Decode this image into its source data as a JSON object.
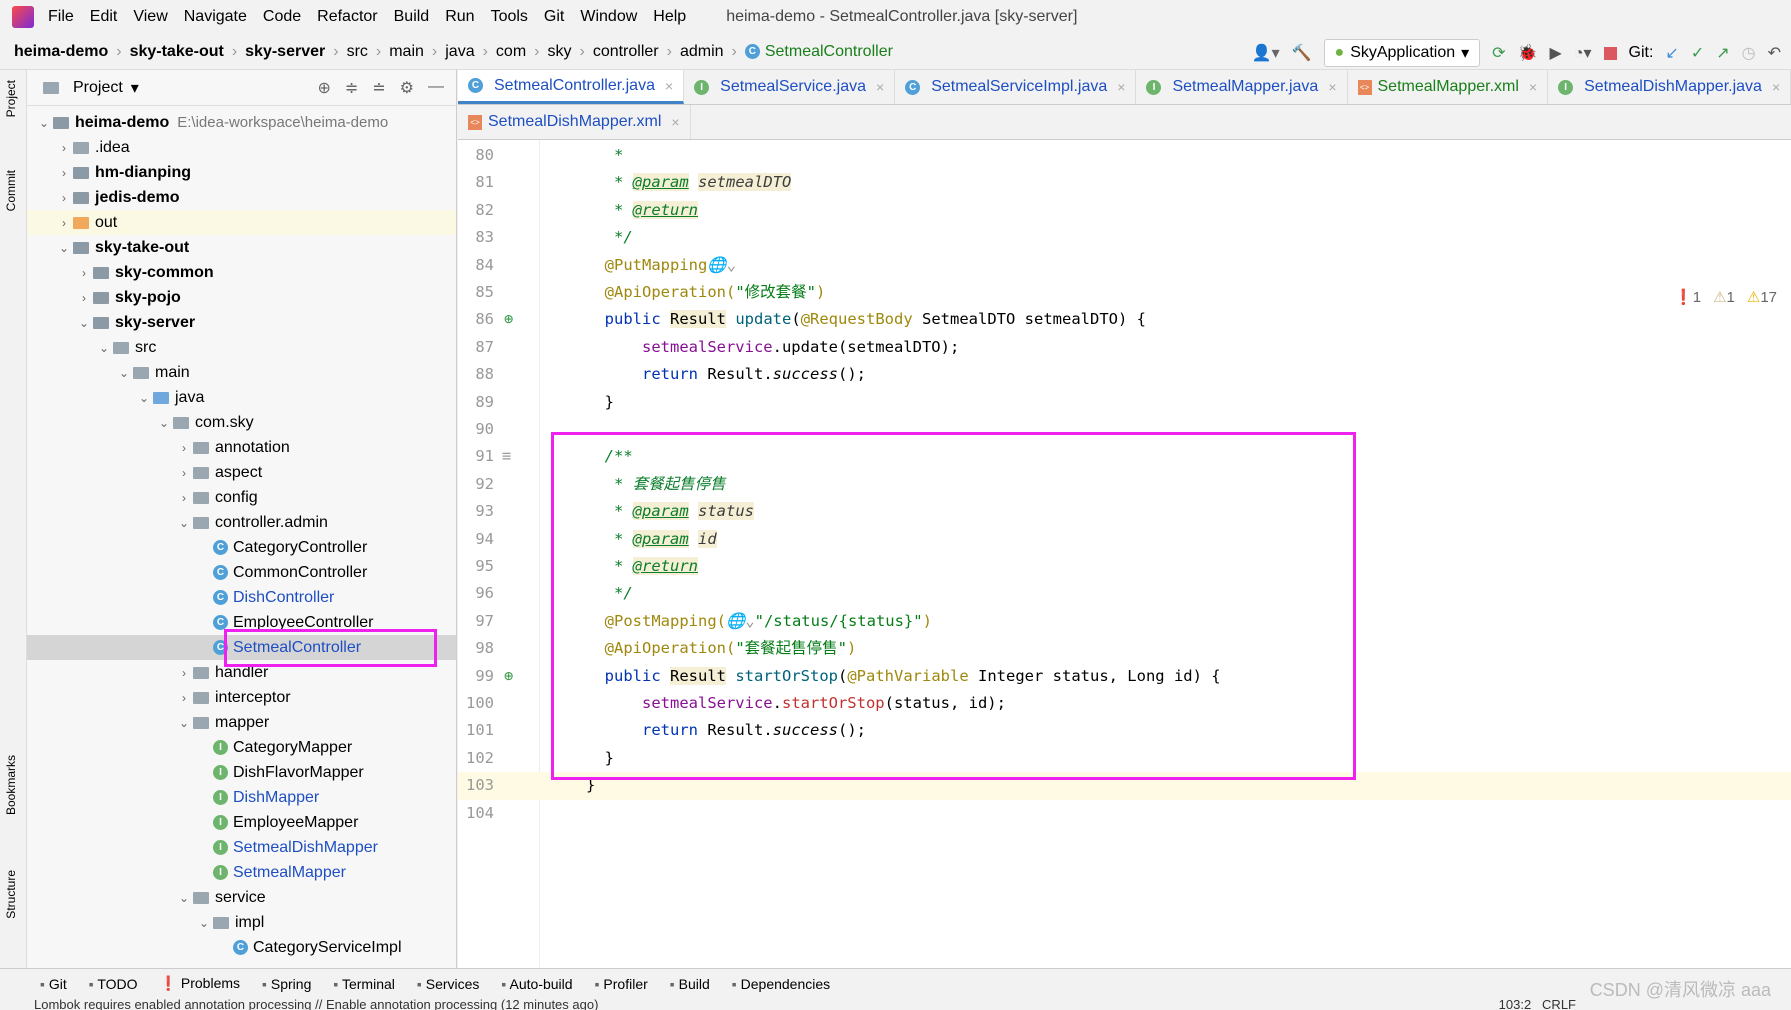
{
  "menu": {
    "items": [
      "File",
      "Edit",
      "View",
      "Navigate",
      "Code",
      "Refactor",
      "Build",
      "Run",
      "Tools",
      "Git",
      "Window",
      "Help"
    ],
    "title": "heima-demo - SetmealController.java [sky-server]"
  },
  "breadcrumb": [
    "heima-demo",
    "sky-take-out",
    "sky-server",
    "src",
    "main",
    "java",
    "com",
    "sky",
    "controller",
    "admin",
    "SetmealController"
  ],
  "toolbar": {
    "run_config": "SkyApplication",
    "git_label": "Git:"
  },
  "left_strip": {
    "project": "Project",
    "commit": "Commit",
    "bookmarks": "Bookmarks",
    "structure": "Structure"
  },
  "project": {
    "title": "Project",
    "root": "heima-demo",
    "root_path": "E:\\idea-workspace\\heima-demo",
    "rows": [
      {
        "label": ".idea",
        "depth": 1,
        "arrow": "›",
        "type": "folder"
      },
      {
        "label": "hm-dianping",
        "depth": 1,
        "arrow": "›",
        "type": "module",
        "bold": true
      },
      {
        "label": "jedis-demo",
        "depth": 1,
        "arrow": "›",
        "type": "module",
        "bold": true
      },
      {
        "label": "out",
        "depth": 1,
        "arrow": "›",
        "type": "out"
      },
      {
        "label": "sky-take-out",
        "depth": 1,
        "arrow": "⌄",
        "type": "module",
        "bold": true
      },
      {
        "label": "sky-common",
        "depth": 2,
        "arrow": "›",
        "type": "module",
        "bold": true
      },
      {
        "label": "sky-pojo",
        "depth": 2,
        "arrow": "›",
        "type": "module",
        "bold": true
      },
      {
        "label": "sky-server",
        "depth": 2,
        "arrow": "⌄",
        "type": "module",
        "bold": true
      },
      {
        "label": "src",
        "depth": 3,
        "arrow": "⌄",
        "type": "folder"
      },
      {
        "label": "main",
        "depth": 4,
        "arrow": "⌄",
        "type": "folder"
      },
      {
        "label": "java",
        "depth": 5,
        "arrow": "⌄",
        "type": "src"
      },
      {
        "label": "com.sky",
        "depth": 6,
        "arrow": "⌄",
        "type": "folder"
      },
      {
        "label": "annotation",
        "depth": 7,
        "arrow": "›",
        "type": "folder"
      },
      {
        "label": "aspect",
        "depth": 7,
        "arrow": "›",
        "type": "folder"
      },
      {
        "label": "config",
        "depth": 7,
        "arrow": "›",
        "type": "folder"
      },
      {
        "label": "controller.admin",
        "depth": 7,
        "arrow": "⌄",
        "type": "folder"
      },
      {
        "label": "CategoryController",
        "depth": 8,
        "type": "class"
      },
      {
        "label": "CommonController",
        "depth": 8,
        "type": "class"
      },
      {
        "label": "DishController",
        "depth": 8,
        "type": "class",
        "blue": true
      },
      {
        "label": "EmployeeController",
        "depth": 8,
        "type": "class"
      },
      {
        "label": "SetmealController",
        "depth": 8,
        "type": "class",
        "blue": true,
        "selected": true
      },
      {
        "label": "handler",
        "depth": 7,
        "arrow": "›",
        "type": "folder"
      },
      {
        "label": "interceptor",
        "depth": 7,
        "arrow": "›",
        "type": "folder"
      },
      {
        "label": "mapper",
        "depth": 7,
        "arrow": "⌄",
        "type": "folder"
      },
      {
        "label": "CategoryMapper",
        "depth": 8,
        "type": "interface"
      },
      {
        "label": "DishFlavorMapper",
        "depth": 8,
        "type": "interface"
      },
      {
        "label": "DishMapper",
        "depth": 8,
        "type": "interface",
        "blue": true
      },
      {
        "label": "EmployeeMapper",
        "depth": 8,
        "type": "interface"
      },
      {
        "label": "SetmealDishMapper",
        "depth": 8,
        "type": "interface",
        "blue": true
      },
      {
        "label": "SetmealMapper",
        "depth": 8,
        "type": "interface",
        "blue": true
      },
      {
        "label": "service",
        "depth": 7,
        "arrow": "⌄",
        "type": "folder"
      },
      {
        "label": "impl",
        "depth": 8,
        "arrow": "⌄",
        "type": "folder"
      },
      {
        "label": "CategoryServiceImpl",
        "depth": 9,
        "type": "class"
      }
    ]
  },
  "tabs_row1": [
    {
      "label": "SetmealController.java",
      "icon": "C",
      "active": true
    },
    {
      "label": "SetmealService.java",
      "icon": "I"
    },
    {
      "label": "SetmealServiceImpl.java",
      "icon": "C"
    },
    {
      "label": "SetmealMapper.java",
      "icon": "I"
    },
    {
      "label": "SetmealMapper.xml",
      "icon": "xml"
    },
    {
      "label": "SetmealDishMapper.java",
      "icon": "I"
    }
  ],
  "tabs_row2": [
    {
      "label": "SetmealDishMapper.xml",
      "icon": "xml"
    }
  ],
  "inspections": {
    "errors": "1",
    "warnings_weak": "1",
    "warnings": "17"
  },
  "code": [
    {
      "n": "80",
      "t": [
        [
          "doc",
          "   *"
        ]
      ]
    },
    {
      "n": "81",
      "t": [
        [
          "doc",
          "   * "
        ],
        [
          "tag",
          "@param"
        ],
        [
          "doc",
          " "
        ],
        [
          "par",
          "setmealDTO"
        ]
      ]
    },
    {
      "n": "82",
      "t": [
        [
          "doc",
          "   * "
        ],
        [
          "tag",
          "@return"
        ]
      ]
    },
    {
      "n": "83",
      "t": [
        [
          "doc",
          "   */"
        ]
      ]
    },
    {
      "n": "84",
      "t": [
        [
          "an",
          "  @PutMapping"
        ],
        [
          "cm",
          "🌐⌄"
        ]
      ]
    },
    {
      "n": "85",
      "t": [
        [
          "an",
          "  @ApiOperation("
        ],
        [
          "str",
          "\"修改套餐\""
        ],
        [
          "an",
          ")"
        ]
      ]
    },
    {
      "n": "86",
      "t": [
        [
          "kw",
          "  public "
        ],
        [
          "hlw",
          "Result"
        ],
        [
          "",
          " "
        ],
        [
          "meth",
          "update"
        ],
        [
          "",
          "("
        ],
        [
          "an",
          "@RequestBody "
        ],
        [
          "",
          "SetmealDTO setmealDTO) {"
        ]
      ]
    },
    {
      "n": "87",
      "t": [
        [
          "fld",
          "      setmealService"
        ],
        [
          "",
          ".update(setmealDTO);"
        ]
      ]
    },
    {
      "n": "88",
      "t": [
        [
          "kw",
          "      return "
        ],
        [
          "",
          "Result."
        ],
        [
          "it",
          "success"
        ],
        [
          "",
          "();"
        ]
      ]
    },
    {
      "n": "89",
      "t": [
        [
          "",
          "  }"
        ]
      ]
    },
    {
      "n": "90",
      "t": []
    },
    {
      "n": "91",
      "t": [
        [
          "doc",
          "  /**"
        ]
      ]
    },
    {
      "n": "92",
      "t": [
        [
          "doc",
          "   * 套餐起售停售"
        ]
      ]
    },
    {
      "n": "93",
      "t": [
        [
          "doc",
          "   * "
        ],
        [
          "tag",
          "@param"
        ],
        [
          "doc",
          " "
        ],
        [
          "par",
          "status"
        ]
      ]
    },
    {
      "n": "94",
      "t": [
        [
          "doc",
          "   * "
        ],
        [
          "tag",
          "@param"
        ],
        [
          "doc",
          " "
        ],
        [
          "par",
          "id"
        ]
      ]
    },
    {
      "n": "95",
      "t": [
        [
          "doc",
          "   * "
        ],
        [
          "tag",
          "@return"
        ]
      ]
    },
    {
      "n": "96",
      "t": [
        [
          "doc",
          "   */"
        ]
      ]
    },
    {
      "n": "97",
      "t": [
        [
          "an",
          "  @PostMapping("
        ],
        [
          "cm",
          "🌐⌄"
        ],
        [
          "str",
          "\"/status/{status}\""
        ],
        [
          "an",
          ")"
        ]
      ]
    },
    {
      "n": "98",
      "t": [
        [
          "an",
          "  @ApiOperation("
        ],
        [
          "str",
          "\"套餐起售停售\""
        ],
        [
          "an",
          ")"
        ]
      ]
    },
    {
      "n": "99",
      "t": [
        [
          "kw",
          "  public "
        ],
        [
          "hlw",
          "Result"
        ],
        [
          "",
          " "
        ],
        [
          "meth",
          "startOrStop"
        ],
        [
          "",
          "("
        ],
        [
          "an",
          "@PathVariable "
        ],
        [
          "",
          "Integer status, Long id) {"
        ]
      ]
    },
    {
      "n": "100",
      "t": [
        [
          "fld",
          "      setmealService"
        ],
        [
          "",
          "."
        ],
        [
          "red",
          "startOrStop"
        ],
        [
          "",
          "(status, id);"
        ]
      ]
    },
    {
      "n": "101",
      "t": [
        [
          "kw",
          "      return "
        ],
        [
          "",
          "Result."
        ],
        [
          "it",
          "success"
        ],
        [
          "",
          "();"
        ]
      ]
    },
    {
      "n": "102",
      "t": [
        [
          "",
          "  }"
        ]
      ]
    },
    {
      "n": "103",
      "t": [
        [
          "",
          "}"
        ]
      ],
      "current": true
    },
    {
      "n": "104",
      "t": []
    }
  ],
  "bottom_tools": [
    "Git",
    "TODO",
    "Problems",
    "Spring",
    "Terminal",
    "Services",
    "Auto-build",
    "Profiler",
    "Build",
    "Dependencies"
  ],
  "status": {
    "message": "Lombok requires enabled annotation processing // Enable annotation processing (12 minutes ago)",
    "position": "103:2",
    "line_sep": "CRLF"
  },
  "watermark": "CSDN @清风微凉 aaa"
}
